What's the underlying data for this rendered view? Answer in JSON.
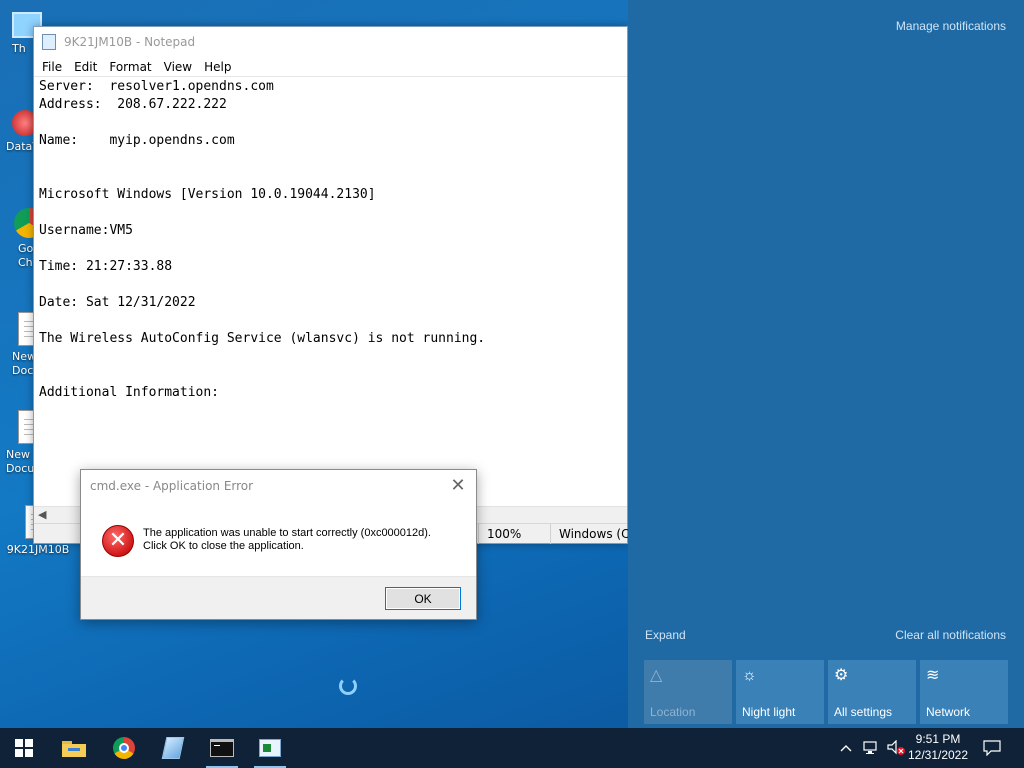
{
  "desktop": {
    "icons": [
      {
        "label": "Th"
      },
      {
        "label": "DataV"
      },
      {
        "label": "Go Ch"
      },
      {
        "label": "New Doc"
      },
      {
        "label": "New Docu"
      },
      {
        "label": "9K21JM10B"
      }
    ]
  },
  "notepad": {
    "title": "9K21JM10B - Notepad",
    "menu": [
      "File",
      "Edit",
      "Format",
      "View",
      "Help"
    ],
    "content": "Server:  resolver1.opendns.com\nAddress:  208.67.222.222\n\nName:    myip.opendns.com\n\n\nMicrosoft Windows [Version 10.0.19044.2130]\n\nUsername:VM5\n\nTime: 21:27:33.88\n\nDate: Sat 12/31/2022\n\nThe Wireless AutoConfig Service (wlansvc) is not running.\n\n\nAdditional Information:",
    "status": {
      "zoom": "100%",
      "line_ending": "Windows (CRLF)"
    }
  },
  "dialog": {
    "title": "cmd.exe - Application Error",
    "message_line1": "The application was unable to start correctly (0xc000012d).",
    "message_line2": "Click OK to close the application.",
    "ok_label": "OK"
  },
  "action_center": {
    "manage_notifications": "Manage notifications",
    "expand": "Expand",
    "clear_all": "Clear all notifications",
    "tiles": [
      {
        "label": "Location",
        "icon": "location-icon",
        "enabled": false
      },
      {
        "label": "Night light",
        "icon": "brightness-icon",
        "enabled": true
      },
      {
        "label": "All settings",
        "icon": "gear-icon",
        "enabled": true
      },
      {
        "label": "Network",
        "icon": "network-icon",
        "enabled": true
      }
    ]
  },
  "taskbar": {
    "time": "9:51 PM",
    "date": "12/31/2022"
  },
  "colors": {
    "action_center_bg": "#1f6aa4",
    "taskbar_bg": "#0f2238",
    "error_red": "#d01818"
  }
}
